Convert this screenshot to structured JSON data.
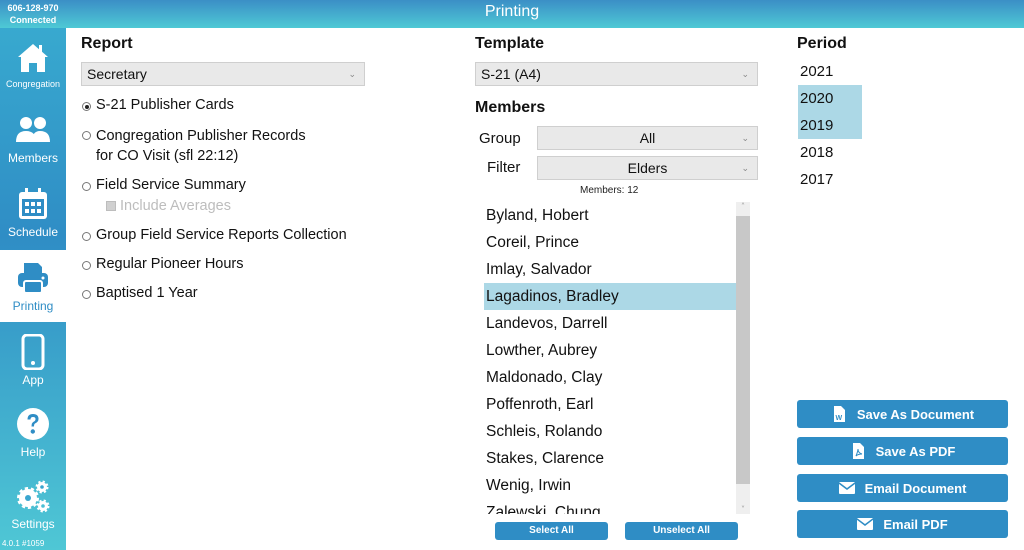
{
  "header": {
    "title": "Printing",
    "connection_id": "606-128-970",
    "connection_status": "Connected"
  },
  "sidebar": {
    "items": [
      {
        "label": "Congregation",
        "icon": "home-icon"
      },
      {
        "label": "Members",
        "icon": "users-icon"
      },
      {
        "label": "Schedule",
        "icon": "calendar-icon"
      },
      {
        "label": "Printing",
        "icon": "printer-icon",
        "active": true
      },
      {
        "label": "App",
        "icon": "phone-icon"
      },
      {
        "label": "Help",
        "icon": "help-icon"
      },
      {
        "label": "Settings",
        "icon": "gears-icon"
      }
    ],
    "version": "4.0.1 #1059"
  },
  "report": {
    "heading": "Report",
    "select_value": "Secretary",
    "options": [
      {
        "label": "S-21 Publisher Cards",
        "selected": true
      },
      {
        "label": "Congregation Publisher Records",
        "label2": "for CO Visit (sfl 22:12)",
        "selected": false
      },
      {
        "label": "Field Service Summary",
        "selected": false
      },
      {
        "label": "Group Field Service Reports Collection",
        "selected": false
      },
      {
        "label": "Regular Pioneer Hours",
        "selected": false
      },
      {
        "label": "Baptised 1 Year",
        "selected": false
      }
    ],
    "include_averages": {
      "label": "Include Averages",
      "checked": false,
      "disabled": true
    }
  },
  "template": {
    "heading": "Template",
    "select_value": "S-21 (A4)"
  },
  "members": {
    "heading": "Members",
    "group_label": "Group",
    "group_value": "All",
    "filter_label": "Filter",
    "filter_value": "Elders",
    "count_text": "Members: 12",
    "list": [
      {
        "name": "Byland, Hobert",
        "selected": false
      },
      {
        "name": "Coreil, Prince",
        "selected": false
      },
      {
        "name": "Imlay, Salvador",
        "selected": false
      },
      {
        "name": "Lagadinos, Bradley",
        "selected": true
      },
      {
        "name": "Landevos, Darrell",
        "selected": false
      },
      {
        "name": "Lowther, Aubrey",
        "selected": false
      },
      {
        "name": "Maldonado, Clay",
        "selected": false
      },
      {
        "name": "Poffenroth, Earl",
        "selected": false
      },
      {
        "name": "Schleis, Rolando",
        "selected": false
      },
      {
        "name": "Stakes, Clarence",
        "selected": false
      },
      {
        "name": "Wenig, Irwin",
        "selected": false
      },
      {
        "name": "Zalewski, Chung",
        "selected": false
      }
    ],
    "select_all_label": "Select All",
    "unselect_all_label": "Unselect All"
  },
  "period": {
    "heading": "Period",
    "years": [
      {
        "label": "2021",
        "selected": false
      },
      {
        "label": "2020",
        "selected": true
      },
      {
        "label": "2019",
        "selected": true
      },
      {
        "label": "2018",
        "selected": false
      },
      {
        "label": "2017",
        "selected": false
      }
    ]
  },
  "actions": {
    "save_document": "Save As Document",
    "save_pdf": "Save As PDF",
    "email_document": "Email Document",
    "email_pdf": "Email PDF"
  },
  "colors": {
    "accent": "#2f8dc5",
    "selection": "#acd8e6",
    "topbar_gradient_end": "#4ec9d5"
  }
}
